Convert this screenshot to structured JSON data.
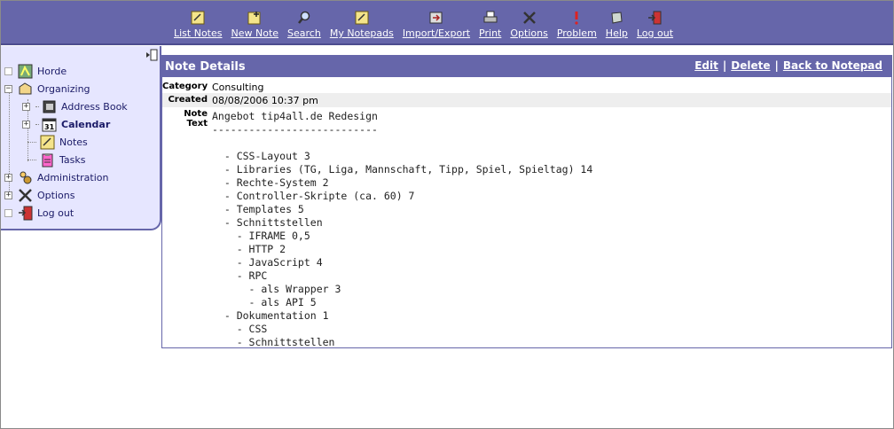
{
  "menu": [
    {
      "icon": "list-notes-icon",
      "label": "List Notes"
    },
    {
      "icon": "new-note-icon",
      "label": "New Note"
    },
    {
      "icon": "search-icon",
      "label": "Search"
    },
    {
      "icon": "my-notepads-icon",
      "label": "My Notepads"
    },
    {
      "icon": "import-export-icon",
      "label": "Import/Export"
    },
    {
      "icon": "print-icon",
      "label": "Print"
    },
    {
      "icon": "options-icon",
      "label": "Options"
    },
    {
      "icon": "problem-icon",
      "label": "Problem"
    },
    {
      "icon": "help-icon",
      "label": "Help"
    },
    {
      "icon": "logout-icon",
      "label": "Log out"
    }
  ],
  "sidebar": {
    "items": [
      {
        "label": "Horde"
      },
      {
        "label": "Organizing"
      },
      {
        "label": "Address Book"
      },
      {
        "label": "Calendar"
      },
      {
        "label": "Notes"
      },
      {
        "label": "Tasks"
      },
      {
        "label": "Administration"
      },
      {
        "label": "Options"
      },
      {
        "label": "Log out"
      }
    ]
  },
  "note": {
    "title": "Note Details",
    "actions": {
      "edit": "Edit",
      "delete": "Delete",
      "back": "Back to Notepad"
    },
    "category_label": "Category",
    "category": "Consulting",
    "created_label": "Created",
    "created": "08/08/2006 10:37 pm",
    "text_label": "Note Text",
    "text": "Angebot tip4all.de Redesign\n---------------------------\n\n  - CSS-Layout 3\n  - Libraries (TG, Liga, Mannschaft, Tipp, Spiel, Spieltag) 14\n  - Rechte-System 2\n  - Controller-Skripte (ca. 60) 7\n  - Templates 5\n  - Schnittstellen\n    - IFRAME 0,5\n    - HTTP 2\n    - JavaScript 4\n    - RPC\n      - als Wrapper 3\n      - als API 5\n  - Dokumentation 1\n    - CSS\n    - Schnittstellen"
  },
  "colors": {
    "accent": "#6666aa",
    "sidebar_bg": "#e6e6ff"
  }
}
